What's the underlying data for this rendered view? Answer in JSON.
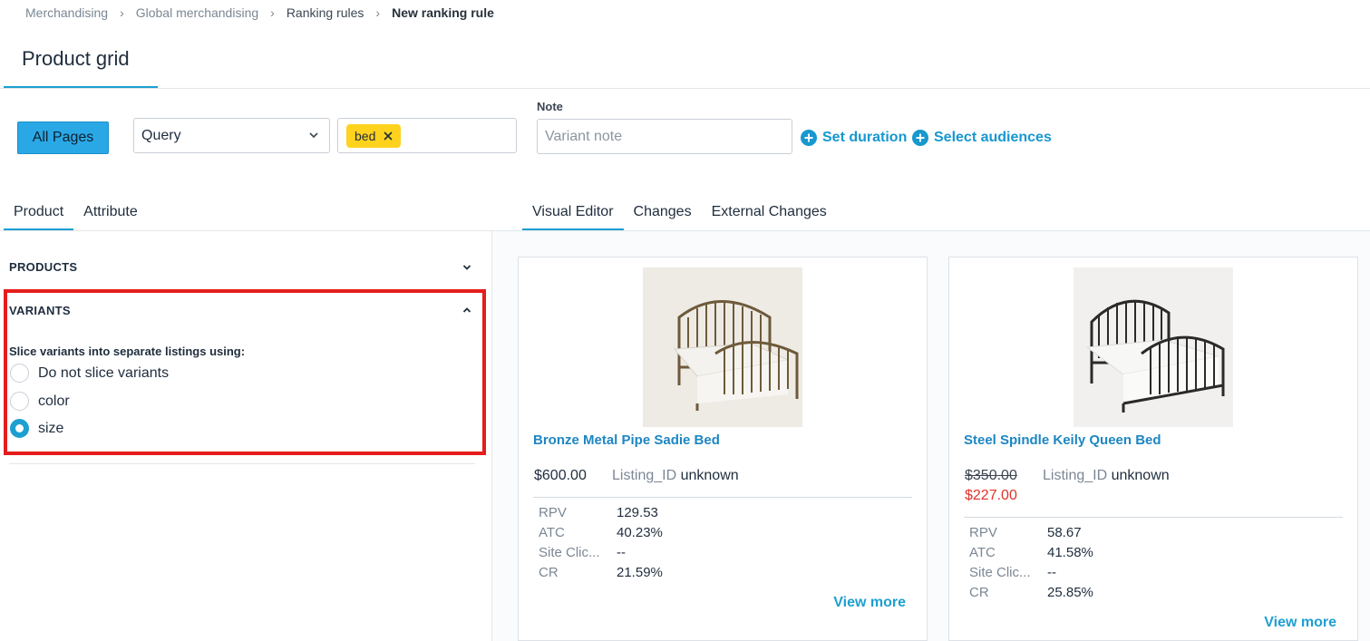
{
  "breadcrumb": [
    "Merchandising",
    "Global merchandising",
    "Ranking rules",
    "New ranking rule"
  ],
  "page_tab": "Product grid",
  "controls": {
    "all_pages": "All Pages",
    "query_select": "Query",
    "tag": "bed",
    "note_label": "Note",
    "note_placeholder": "Variant note",
    "set_duration": "Set duration",
    "select_audiences": "Select audiences"
  },
  "left_tabs": [
    "Product",
    "Attribute"
  ],
  "right_tabs": [
    "Visual Editor",
    "Changes",
    "External Changes"
  ],
  "sections": {
    "products": "PRODUCTS",
    "variants": "VARIANTS",
    "slice_label": "Slice variants into separate listings using:",
    "options": [
      "Do not slice variants",
      "color",
      "size"
    ],
    "selected_option": "size"
  },
  "cards": [
    {
      "title": "Bronze Metal Pipe Sadie Bed",
      "price": "$600.00",
      "listing_label": "Listing_ID",
      "listing_value": "unknown",
      "metrics": [
        {
          "k": "RPV",
          "v": "129.53"
        },
        {
          "k": "ATC",
          "v": "40.23%"
        },
        {
          "k": "Site Clic...",
          "v": "--"
        },
        {
          "k": "CR",
          "v": "21.59%"
        }
      ],
      "view_more": "View more"
    },
    {
      "title": "Steel Spindle Keily Queen Bed",
      "price_old": "$350.00",
      "price_sale": "$227.00",
      "listing_label": "Listing_ID",
      "listing_value": "unknown",
      "metrics": [
        {
          "k": "RPV",
          "v": "58.67"
        },
        {
          "k": "ATC",
          "v": "41.58%"
        },
        {
          "k": "Site Clic...",
          "v": "--"
        },
        {
          "k": "CR",
          "v": "25.85%"
        }
      ],
      "view_more": "View more"
    }
  ],
  "colors": {
    "accent": "#1d9fd1",
    "highlight": "#e51d1d",
    "tag": "#ffd21e",
    "sale": "#e0322b"
  },
  "icons": [
    "chevron-right-icon",
    "chevron-down-icon",
    "chevron-up-icon",
    "close-icon",
    "plus-circle-icon"
  ]
}
